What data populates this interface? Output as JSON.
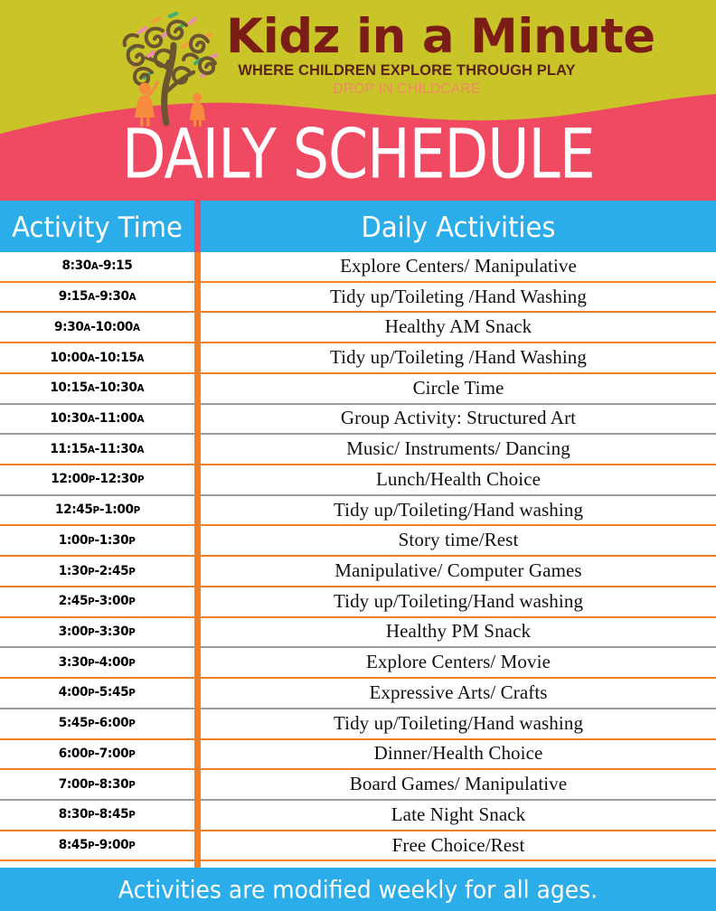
{
  "brand": {
    "name": "Kidz in a Minute",
    "tagline": "WHERE CHILDREN EXPLORE THROUGH PLAY",
    "subtagline": "DROP IN CHILDCARE",
    "logo_icon": "swirly-tree-with-children-icon"
  },
  "title": "DAILY SCHEDULE",
  "columns": {
    "time": "Activity Time",
    "activity": "Daily Activities"
  },
  "colors": {
    "banner_olive": "#c9c427",
    "title_pink": "#f04a62",
    "header_blue": "#2badea",
    "rule_orange": "#f07f26",
    "rule_grey": "#9b9b9b",
    "brand_maroon": "#7b1d16",
    "tagline_brown": "#5a2318",
    "subtagline_coral": "#f4876a"
  },
  "rows": [
    {
      "time": "8:30",
      "time_mer": "A",
      "time2": "-9:15",
      "time2_mer": "",
      "activity": "Explore Centers/ Manipulative",
      "rule": "orange"
    },
    {
      "time": "9:15",
      "time_mer": "A",
      "time2": "-9:30",
      "time2_mer": "A",
      "activity": "Tidy up/Toileting /Hand Washing",
      "rule": "orange"
    },
    {
      "time": "9:30",
      "time_mer": "A",
      "time2": "-10:00",
      "time2_mer": "A",
      "activity": "Healthy AM Snack",
      "rule": "orange"
    },
    {
      "time": "10:00",
      "time_mer": "A",
      "time2": "-10:15",
      "time2_mer": "A",
      "activity": "Tidy up/Toileting /Hand Washing",
      "rule": "orange"
    },
    {
      "time": "10:15",
      "time_mer": "A",
      "time2": "-10:30",
      "time2_mer": "A",
      "activity": "Circle Time",
      "rule": "grey"
    },
    {
      "time": "10:30",
      "time_mer": "A",
      "time2": "-11:00",
      "time2_mer": "A",
      "activity": "Group Activity: Structured Art",
      "rule": "grey"
    },
    {
      "time": "11:15",
      "time_mer": "A",
      "time2": "-11:30",
      "time2_mer": "A",
      "activity": "Music/ Instruments/ Dancing",
      "rule": "orange"
    },
    {
      "time": "12:00",
      "time_mer": "P",
      "time2": "-12:30",
      "time2_mer": "P",
      "activity": "Lunch/Health Choice",
      "rule": "grey"
    },
    {
      "time": "12:45",
      "time_mer": "P",
      "time2": "-1:00",
      "time2_mer": "P",
      "activity": "Tidy up/Toileting/Hand washing",
      "rule": "orange"
    },
    {
      "time": "1:00",
      "time_mer": "P",
      "time2": "-1:30",
      "time2_mer": "P",
      "activity": "Story time/Rest",
      "rule": "orange"
    },
    {
      "time": "1:30",
      "time_mer": "P",
      "time2": "-2:45",
      "time2_mer": "P",
      "activity": "Manipulative/ Computer Games",
      "rule": "orange"
    },
    {
      "time": "2:45",
      "time_mer": "P",
      "time2": "-3:00",
      "time2_mer": "P",
      "activity": "Tidy up/Toileting/Hand washing",
      "rule": "orange"
    },
    {
      "time": "3:00",
      "time_mer": "P",
      "time2": "-3:30",
      "time2_mer": "P",
      "activity": "Healthy PM Snack",
      "rule": "grey"
    },
    {
      "time": "3:30",
      "time_mer": "P",
      "time2": "-4:00",
      "time2_mer": "P",
      "activity": "Explore Centers/ Movie",
      "rule": "orange"
    },
    {
      "time": "4:00",
      "time_mer": "P",
      "time2": "-5:45",
      "time2_mer": "P",
      "activity": "Expressive Arts/ Crafts",
      "rule": "grey"
    },
    {
      "time": "5:45",
      "time_mer": "P",
      "time2": "-6:00",
      "time2_mer": "P",
      "activity": "Tidy up/Toileting/Hand washing",
      "rule": "orange"
    },
    {
      "time": "6:00",
      "time_mer": "P",
      "time2": "-7:00",
      "time2_mer": "P",
      "activity": "Dinner/Health Choice",
      "rule": "orange"
    },
    {
      "time": "7:00",
      "time_mer": "P",
      "time2": "-8:30",
      "time2_mer": "P",
      "activity": "Board Games/ Manipulative",
      "rule": "grey"
    },
    {
      "time": "8:30",
      "time_mer": "P",
      "time2": "-8:45",
      "time2_mer": "P",
      "activity": "Late Night Snack",
      "rule": "orange"
    },
    {
      "time": "8:45",
      "time_mer": "P",
      "time2": "-9:00",
      "time2_mer": "P",
      "activity": "Free Choice/Rest",
      "rule": "orange"
    }
  ],
  "footer": "Activities are modified weekly for all ages."
}
